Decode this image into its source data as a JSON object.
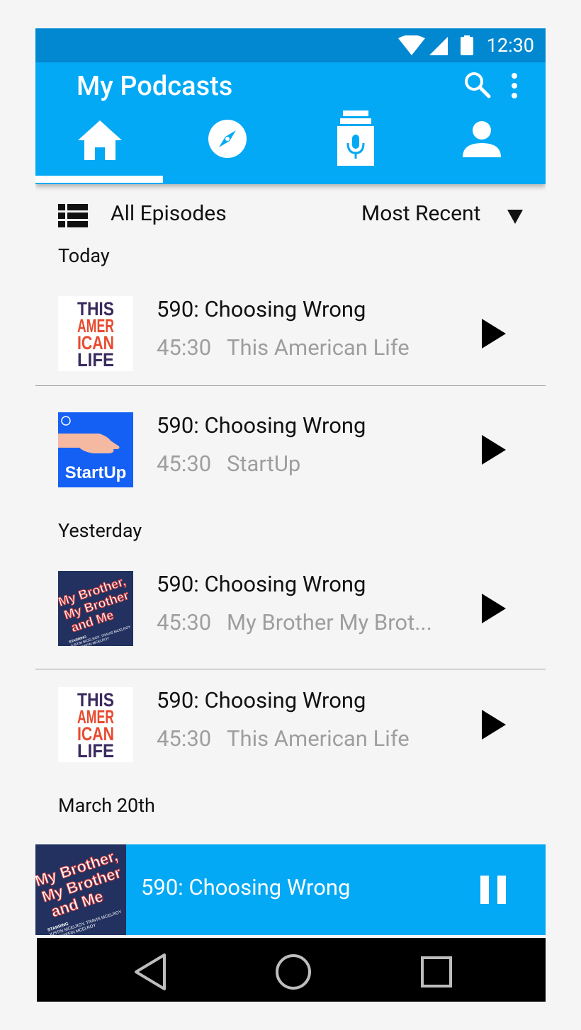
{
  "status_bar": {
    "time": "12:30",
    "icons": [
      "wifi-icon",
      "cell-signal-icon",
      "battery-icon"
    ]
  },
  "app_bar": {
    "title": "My Podcasts",
    "actions": [
      "search-icon",
      "more-vert-icon"
    ],
    "tabs": [
      {
        "icon": "home-icon",
        "selected": true
      },
      {
        "icon": "compass-icon",
        "selected": false
      },
      {
        "icon": "mic-icon",
        "selected": false
      },
      {
        "icon": "person-icon",
        "selected": false
      }
    ]
  },
  "filter": {
    "label": "All Episodes",
    "sort_label": "Most Recent"
  },
  "sections": [
    {
      "label": "Today",
      "episodes": [
        {
          "title": "590: Choosing Wrong",
          "duration": "45:30",
          "show": "This American Life",
          "art": "This American Life"
        },
        {
          "title": "590: Choosing Wrong",
          "duration": "45:30",
          "show": "StartUp",
          "art": "StartUp"
        }
      ]
    },
    {
      "label": "Yesterday",
      "episodes": [
        {
          "title": "590: Choosing Wrong",
          "duration": "45:30",
          "show": "My Brother My Brot...",
          "art": "My Brother, My Brother and Me"
        },
        {
          "title": "590: Choosing Wrong",
          "duration": "45:30",
          "show": "This American Life",
          "art": "This American Life"
        }
      ]
    },
    {
      "label": "March 20th",
      "episodes": []
    }
  ],
  "now_playing": {
    "title": "590: Choosing Wrong",
    "art": "My Brother, My Brother and Me"
  },
  "artwork_text": {
    "tal": [
      "THIS",
      "AMER",
      "ICAN",
      "LIFE"
    ],
    "startup": "StartUp",
    "mbmbam": [
      "My Brother,",
      "My Brother",
      "and Me"
    ],
    "mbmbam_starring": [
      "STARRING",
      "JUSTIN MCELROY, TRAVIS MCELROY",
      "and GRIFFIN MCELROY"
    ]
  },
  "colors": {
    "status_bar": "#0288d1",
    "app_bar": "#03a9f4",
    "player_bar": "#03a9f4",
    "background": "#f5f5f5",
    "secondary_text": "#9e9e9e",
    "tal_red": "#e84a2f",
    "tal_navy": "#3a2a5e",
    "startup_blue": "#1460f5",
    "mbmbam_red": "#d03b3b",
    "mbmbam_bg": "#22315f"
  },
  "nav_bar": [
    "back-icon",
    "home-circle-icon",
    "recents-icon"
  ]
}
